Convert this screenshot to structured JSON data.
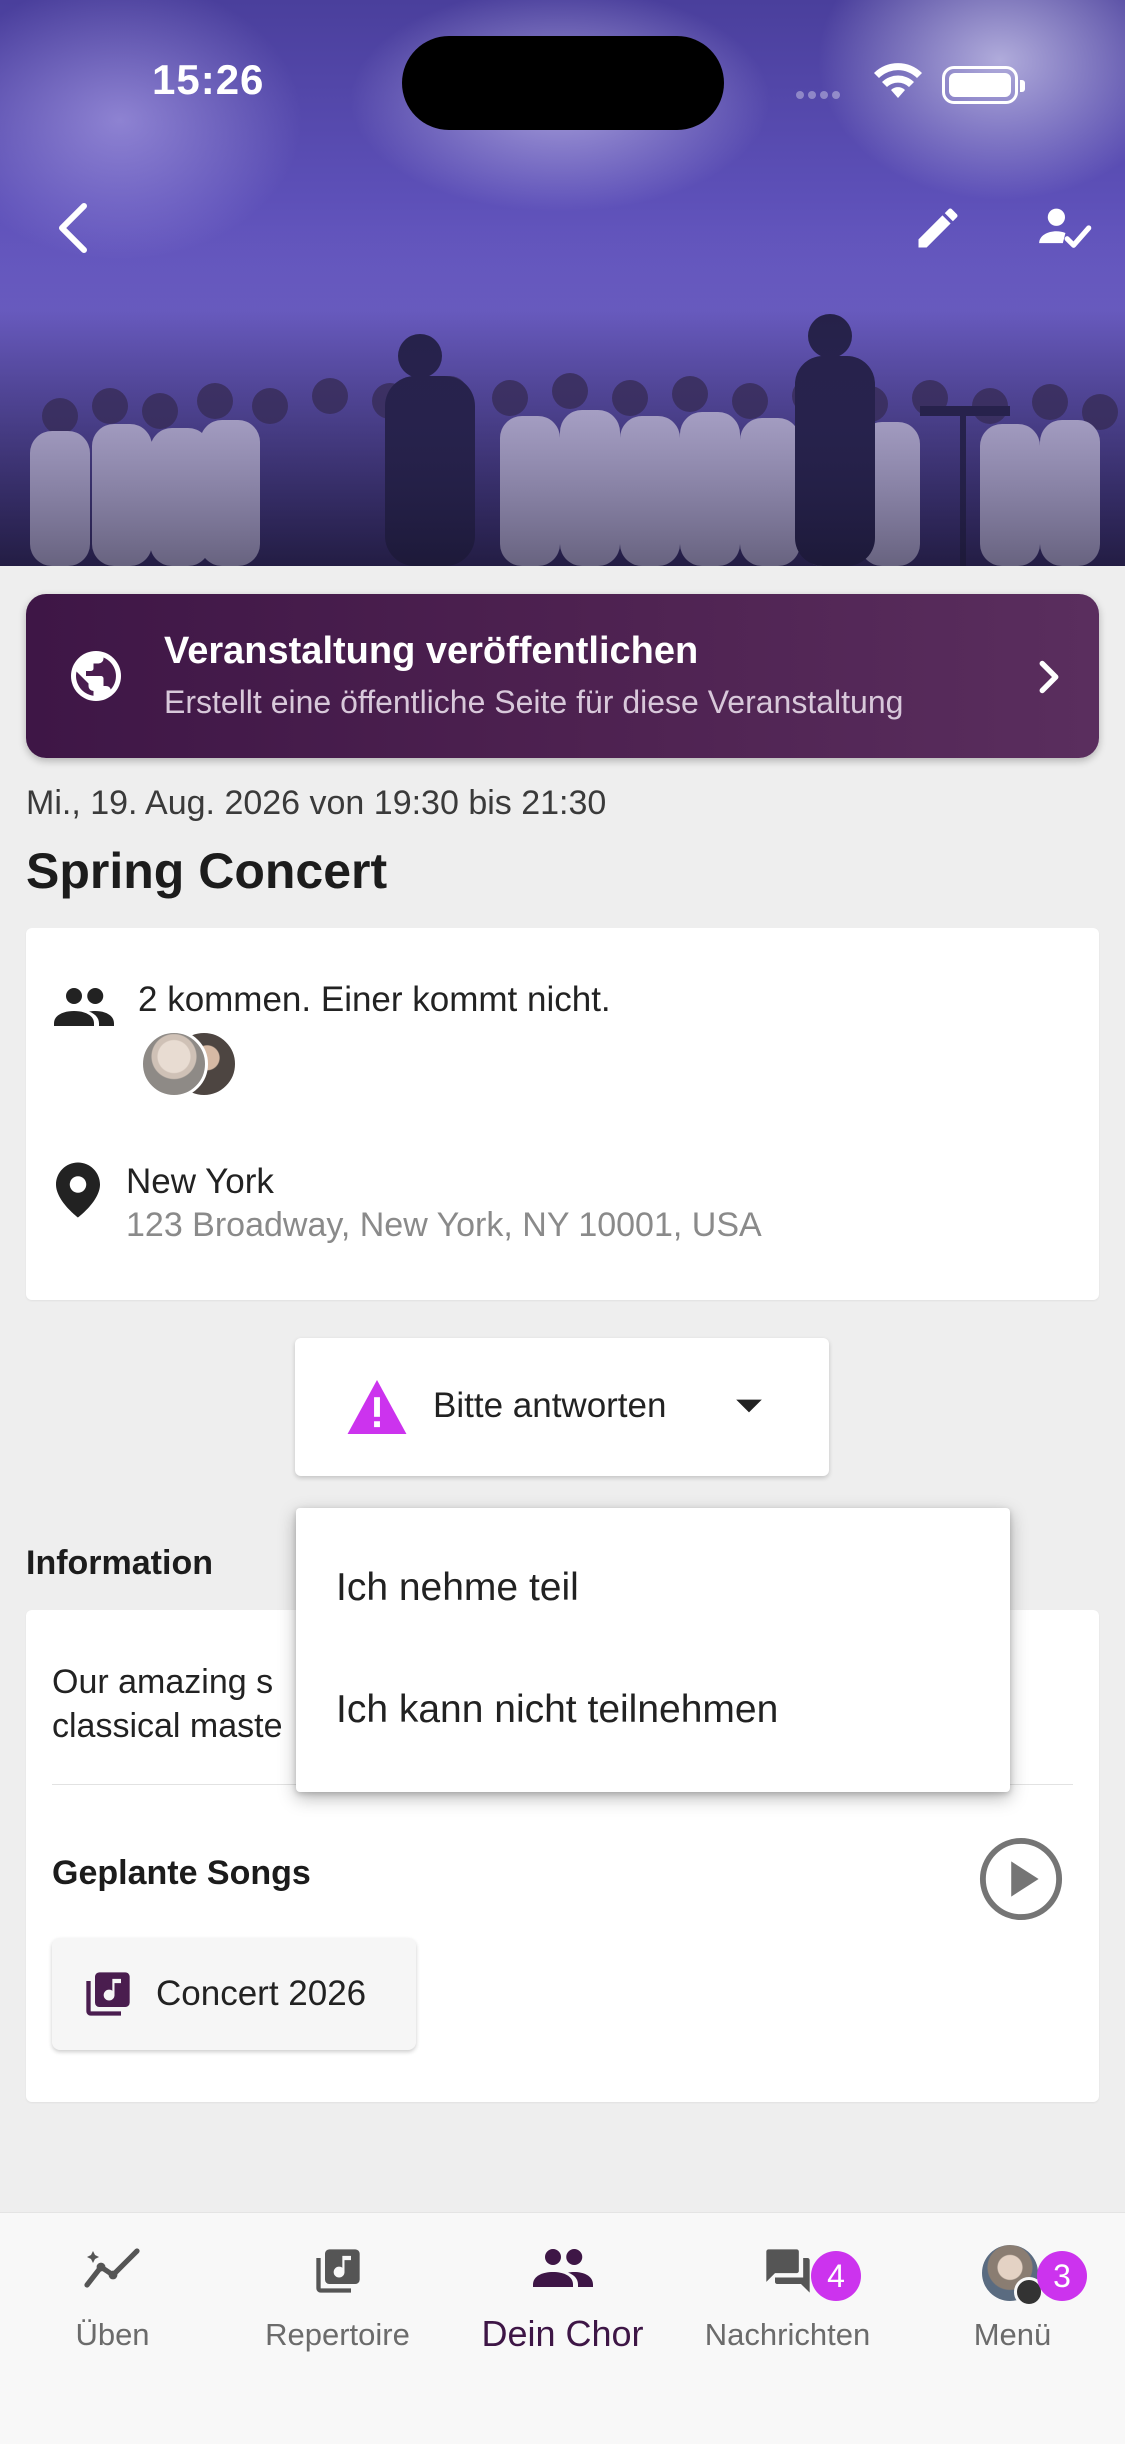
{
  "status": {
    "time": "15:26"
  },
  "publish": {
    "title": "Veranstaltung veröffentlichen",
    "subtitle": "Erstellt eine öffentliche Seite für diese Veranstaltung"
  },
  "event": {
    "datetime": "Mi., 19. Aug. 2026 von 19:30 bis 21:30",
    "title": "Spring Concert",
    "attendance": "2 kommen. Einer kommt nicht.",
    "location_name": "New York",
    "location_address": "123 Broadway, New York, NY 10001, USA"
  },
  "response": {
    "label": "Bitte antworten",
    "options": [
      "Ich nehme teil",
      "Ich kann nicht teilnehmen"
    ]
  },
  "information": {
    "title": "Information",
    "description_visible": "Our amazing s\nclassical maste"
  },
  "songs": {
    "title": "Geplante Songs",
    "items": [
      "Concert 2026"
    ]
  },
  "nav": {
    "tabs": [
      {
        "label": "Üben",
        "icon": "practice-icon"
      },
      {
        "label": "Repertoire",
        "icon": "music-library-icon"
      },
      {
        "label": "Dein Chor",
        "icon": "group-icon",
        "active": true
      },
      {
        "label": "Nachrichten",
        "icon": "chat-icon",
        "badge": "4"
      },
      {
        "label": "Menü",
        "icon": "avatar",
        "badge": "3"
      }
    ]
  },
  "colors": {
    "brand": "#3e1646",
    "badge": "#cc33ee",
    "warning": "#cc33ee"
  }
}
